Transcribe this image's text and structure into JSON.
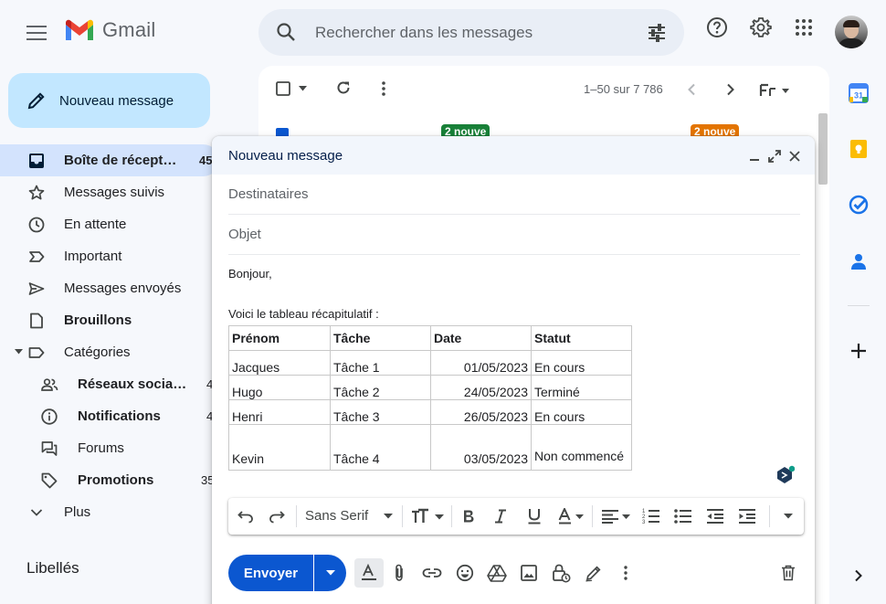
{
  "app": {
    "name": "Gmail"
  },
  "search": {
    "placeholder": "Rechercher dans les messages"
  },
  "sidebar": {
    "compose_label": "Nouveau message",
    "items": [
      {
        "label": "Boîte de récept…",
        "count": "45",
        "icon": "inbox-icon"
      },
      {
        "label": "Messages suivis",
        "icon": "star-icon"
      },
      {
        "label": "En attente",
        "icon": "clock-icon"
      },
      {
        "label": "Important",
        "icon": "important-icon"
      },
      {
        "label": "Messages envoyés",
        "icon": "send-icon"
      },
      {
        "label": "Brouillons",
        "icon": "draft-icon"
      },
      {
        "label": "Catégories",
        "icon": "label-icon"
      },
      {
        "label": "Réseaux socia…",
        "count": "4",
        "icon": "people-icon"
      },
      {
        "label": "Notifications",
        "count": "4",
        "icon": "info-icon"
      },
      {
        "label": "Forums",
        "icon": "forum-icon"
      },
      {
        "label": "Promotions",
        "count": "35",
        "icon": "tag-icon"
      },
      {
        "label": "Plus",
        "icon": "chevron-down-icon"
      }
    ],
    "labels_title": "Libellés"
  },
  "mail_list": {
    "pager": "1–50 sur 7 786",
    "badges": [
      {
        "text": "2 nouve",
        "color": "#188038"
      },
      {
        "text": "2 nouve",
        "color": "#e37400"
      }
    ]
  },
  "compose": {
    "title": "Nouveau message",
    "to_placeholder": "Destinataires",
    "subject_placeholder": "Objet",
    "greeting": "Bonjour,",
    "intro": "Voici le tableau récapitulatif :",
    "table": {
      "headers": [
        "Prénom",
        "Tâche",
        "Date",
        "Statut"
      ],
      "rows": [
        [
          "Jacques",
          "Tâche 1",
          "01/05/2023",
          "En cours"
        ],
        [
          "Hugo",
          "Tâche 2",
          "24/05/2023",
          "Terminé"
        ],
        [
          "Henri",
          "Tâche 3",
          "26/05/2023",
          "En cours"
        ],
        [
          "Kevin",
          "Tâche 4",
          "03/05/2023",
          "Non commencé"
        ]
      ]
    },
    "formatting": {
      "font": "Sans Serif"
    },
    "send_label": "Envoyer"
  },
  "colors": {
    "accent": "#0b57d0",
    "compose_button": "#c2e7ff",
    "active_nav": "#d3e3fd"
  }
}
